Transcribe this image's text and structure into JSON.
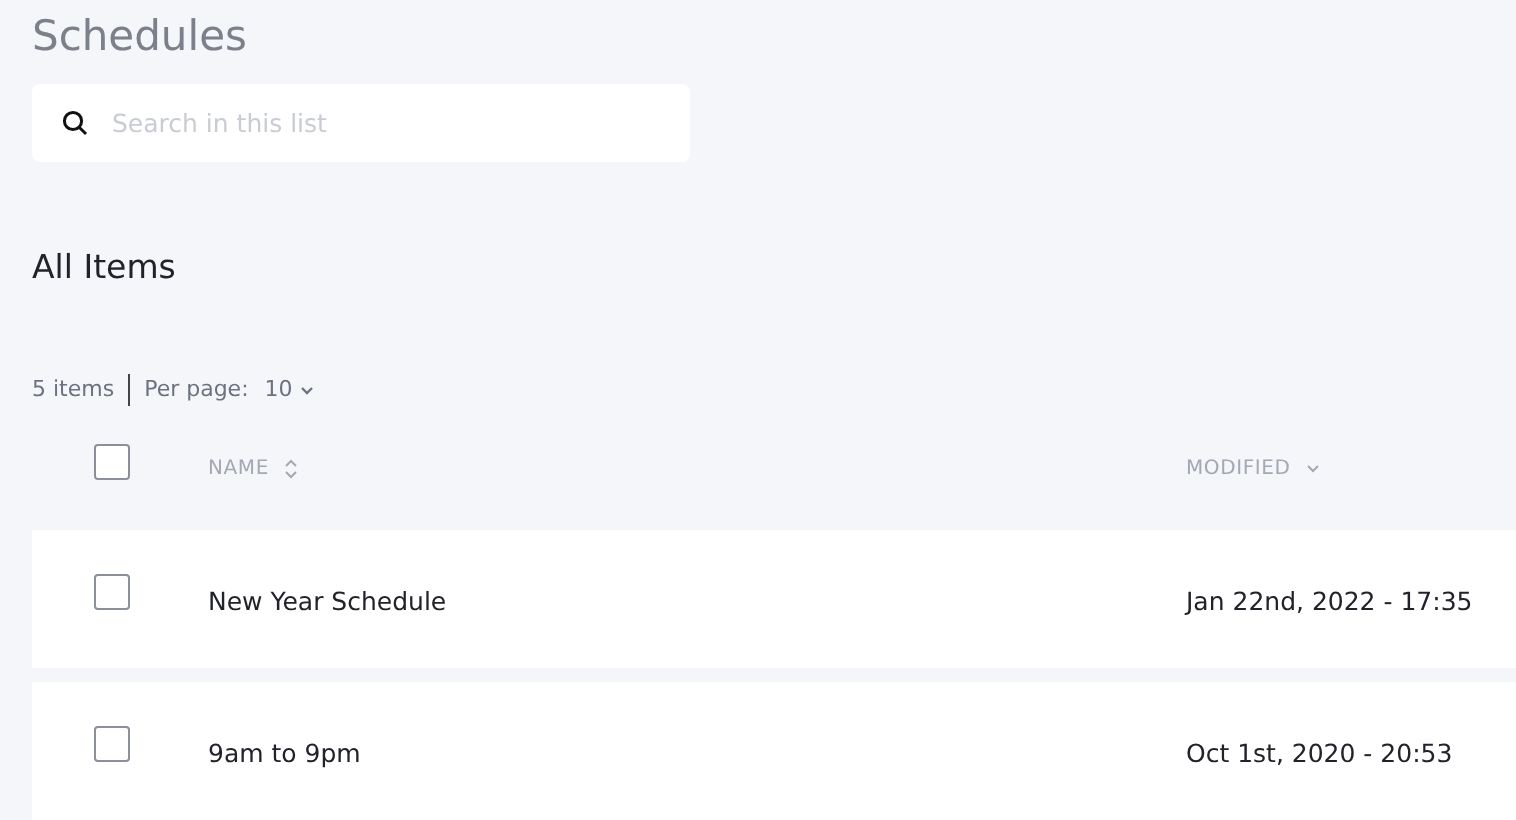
{
  "title": "Schedules",
  "search": {
    "placeholder": "Search in this list"
  },
  "section_title": "All Items",
  "list_meta": {
    "count": "5 items",
    "per_page_label": "Per page:",
    "per_page_value": "10"
  },
  "table": {
    "select_all": {
      "checked": false
    },
    "columns": [
      {
        "label": "NAME",
        "sorted": false
      },
      {
        "label": "MODIFIED",
        "sorted": true
      }
    ],
    "rows": [
      {
        "checked": false,
        "name": "New Year Schedule",
        "modified": "Jan 22nd, 2022 - 17:35"
      },
      {
        "checked": false,
        "name": "9am to 9pm",
        "modified": "Oct 1st, 2020 - 20:53"
      }
    ]
  }
}
